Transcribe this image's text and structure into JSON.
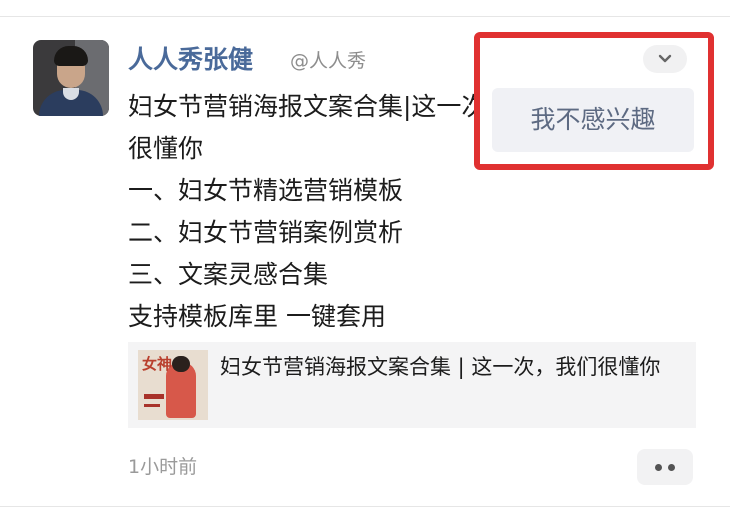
{
  "post": {
    "user_name": "人人秀张健",
    "user_handle": "@人人秀",
    "text_lines": [
      "妇女节营销海报文案合集|这一次，我们",
      "很懂你",
      "一、妇女节精选营销模板",
      "二、妇女节营销案例赏析",
      "三、文案灵感合集",
      "支持模板库里 一键套用"
    ],
    "link_card": {
      "thumb_glyph": "女神",
      "title": "妇女节营销海报文案合集 | 这一次，我们很懂你"
    },
    "timestamp": "1小时前"
  },
  "menu": {
    "not_interested_label": "我不感兴趣"
  },
  "colors": {
    "name_blue": "#4a6a9a",
    "highlight_red": "#e03131",
    "menu_text": "#5d6a82"
  }
}
